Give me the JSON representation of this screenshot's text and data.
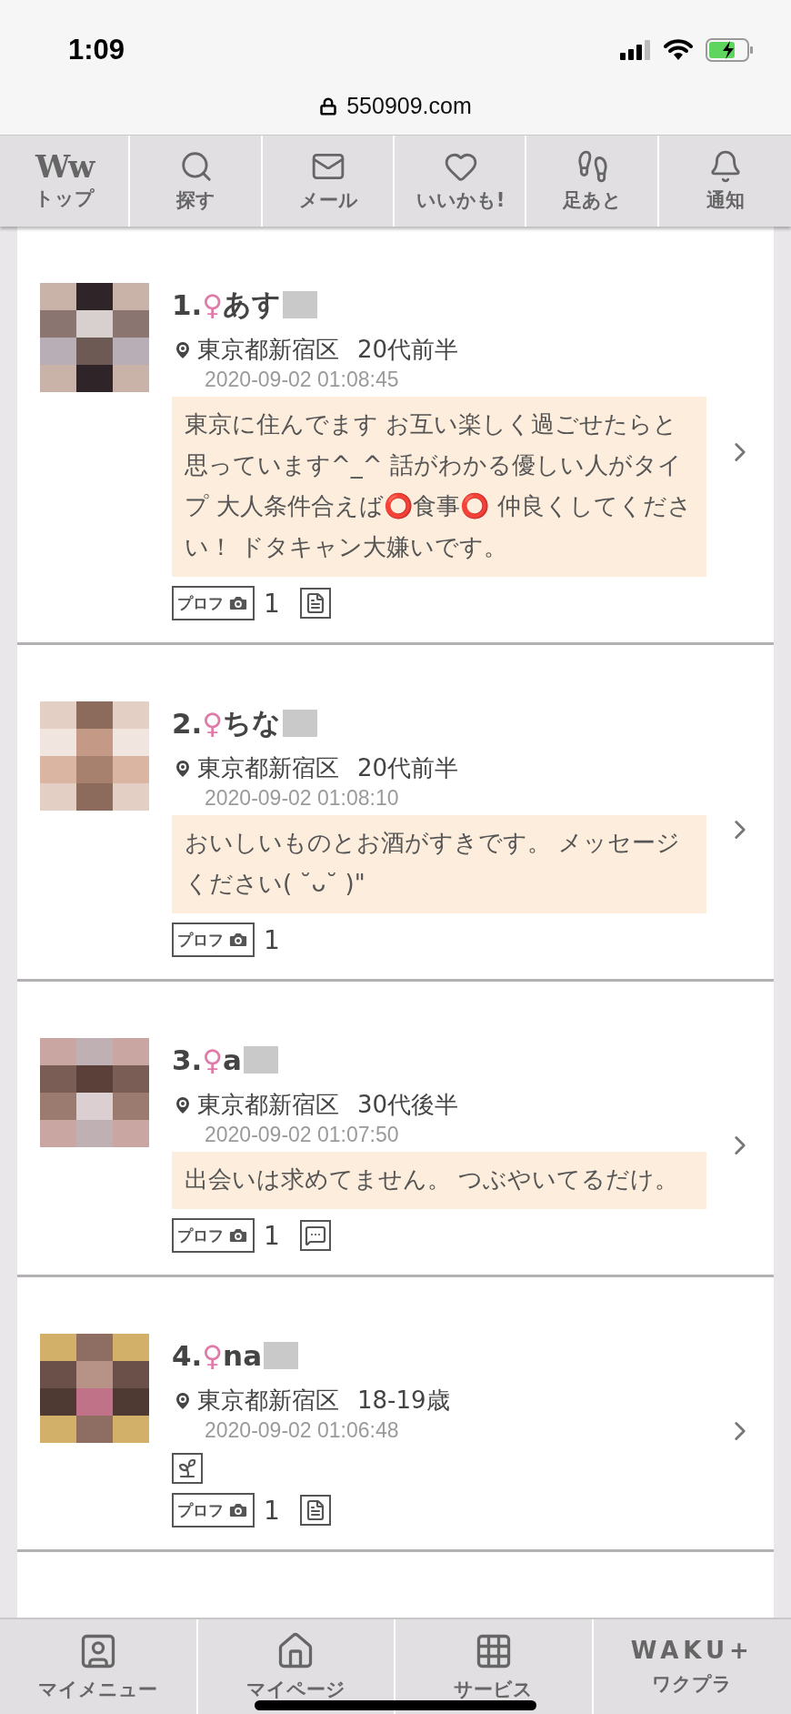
{
  "status_bar": {
    "time": "1:09"
  },
  "address_bar": {
    "url": "550909.com"
  },
  "top_nav": [
    {
      "kind": "logo",
      "label": "トップ",
      "logo": "Ww"
    },
    {
      "kind": "search",
      "label": "探す"
    },
    {
      "kind": "mail",
      "label": "メール"
    },
    {
      "kind": "heart",
      "label": "いいかも!"
    },
    {
      "kind": "footprints",
      "label": "足あと"
    },
    {
      "kind": "bell",
      "label": "通知"
    }
  ],
  "profiles": [
    {
      "rank": "1.",
      "gender_symbol": "♀",
      "name": "あす",
      "location": "東京都新宿区",
      "age": "20代前半",
      "timestamp": "2020-09-02 01:08:45",
      "message": "東京に住んでます お互い楽しく過ごせたらと思っています^_^ 話がわかる優しい人がタイプ 大人条件合えば⭕食事⭕ 仲良くしてください！ ドタキャン大嫌いです。",
      "photo_badge": "プロフ",
      "photo_count": "1",
      "badge_icons": [
        {
          "kind": "document"
        }
      ]
    },
    {
      "rank": "2.",
      "gender_symbol": "♀",
      "name": "ちな",
      "location": "東京都新宿区",
      "age": "20代前半",
      "timestamp": "2020-09-02 01:08:10",
      "message": "おいしいものとお酒がすきです。 メッセージください( ˘ᴗ˘ )\"",
      "photo_badge": "プロフ",
      "photo_count": "1"
    },
    {
      "rank": "3.",
      "gender_symbol": "♀",
      "name": "a",
      "location": "東京都新宿区",
      "age": "30代後半",
      "timestamp": "2020-09-02 01:07:50",
      "message": "出会いは求めてません。 つぶやいてるだけ。",
      "photo_badge": "プロフ",
      "photo_count": "1",
      "badge_icons": [
        {
          "kind": "chat"
        }
      ]
    },
    {
      "rank": "4.",
      "gender_symbol": "♀",
      "name": "na",
      "location": "東京都新宿区",
      "age": "18-19歳",
      "timestamp": "2020-09-02 01:06:48",
      "tag_icons": [
        {
          "kind": "sprout"
        }
      ],
      "photo_badge": "プロフ",
      "photo_count": "1",
      "badge_icons": [
        {
          "kind": "document"
        }
      ]
    }
  ],
  "bottom_nav": [
    {
      "kind": "user",
      "label": "マイメニュー"
    },
    {
      "kind": "home",
      "label": "マイページ"
    },
    {
      "kind": "grid",
      "label": "サービス"
    },
    {
      "kind": "logo",
      "label": "ワクプラ",
      "logo": "WAKU+"
    }
  ]
}
